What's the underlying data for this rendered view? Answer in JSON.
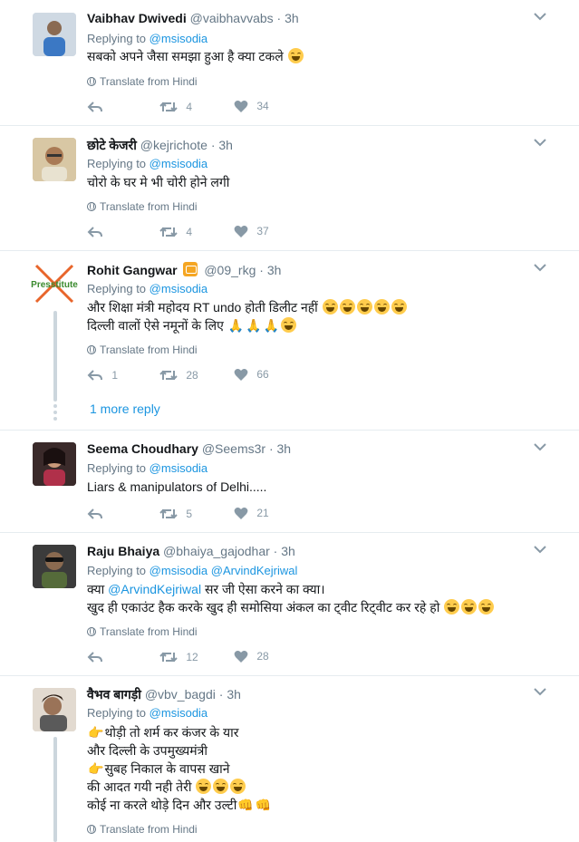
{
  "colors": {
    "accent": "#1b95e0",
    "muted": "#657786",
    "thread": "#ccd6dd"
  },
  "tweets": [
    {
      "name": "Vaibhav Dwivedi",
      "handle": "@vaibhavvabs",
      "dot": "·",
      "time": "3h",
      "replying_prefix": "Replying to",
      "replying_to": [
        "@msisodia"
      ],
      "lines": [
        "सबको अपने जैसा समझा हुआ है क्या टकले"
      ],
      "translate": "Translate from Hindi",
      "replies": "",
      "retweets": "4",
      "likes": "34"
    },
    {
      "name": "छोटे केजरी",
      "handle": "@kejrichote",
      "dot": "·",
      "time": "3h",
      "replying_prefix": "Replying to",
      "replying_to": [
        "@msisodia"
      ],
      "lines": [
        "चोरो के घर मे भी चोरी होने लगी"
      ],
      "translate": "Translate from Hindi",
      "replies": "",
      "retweets": "4",
      "likes": "37"
    },
    {
      "name": "Rohit Gangwar",
      "handle": "@09_rkg",
      "dot": "·",
      "time": "3h",
      "avatar_text": "Presstitute",
      "replying_prefix": "Replying to",
      "replying_to": [
        "@msisodia"
      ],
      "lines": [
        "और शिक्षा मंत्री महोदय RT undo होती डिलीट नहीं",
        "दिल्ली वालों  ऐसे नमूनों के लिए"
      ],
      "translate": "Translate from Hindi",
      "replies": "1",
      "retweets": "28",
      "likes": "66",
      "more_reply": "1 more reply"
    },
    {
      "name": "Seema Choudhary",
      "handle": "@Seems3r",
      "dot": "·",
      "time": "3h",
      "replying_prefix": "Replying to",
      "replying_to": [
        "@msisodia"
      ],
      "lines": [
        "Liars & manipulators of Delhi....."
      ],
      "replies": "",
      "retweets": "5",
      "likes": "21"
    },
    {
      "name": "Raju Bhaiya",
      "handle": "@bhaiya_gajodhar",
      "dot": "·",
      "time": "3h",
      "replying_prefix": "Replying to",
      "replying_to": [
        "@msisodia",
        "@ArvindKejriwal"
      ],
      "line1_pre": "क्या ",
      "line1_mention": "@ArvindKejriwal",
      "line1_post": " सर जी ऐसा करने का क्या।",
      "lines": [
        "खुद ही एकाउंट हैक करके खुद ही समोसिया अंकल का ट्वीट रिट्वीट कर रहे हो"
      ],
      "translate": "Translate from Hindi",
      "replies": "",
      "retweets": "12",
      "likes": "28"
    },
    {
      "name": "वैभव बागड़ी",
      "handle": "@vbv_bagdi",
      "dot": "·",
      "time": "3h",
      "replying_prefix": "Replying to",
      "replying_to": [
        "@msisodia"
      ],
      "lines": [
        "थोड़ी तो शर्म कर कंजर के यार",
        "और दिल्ली के उपमुख्यमंत्री",
        "सुबह निकाल के वापस खाने",
        "की आदत गयी नही तेरी",
        "कोई ना करले थोड़े दिन और उल्टी"
      ],
      "translate": "Translate from Hindi"
    }
  ]
}
